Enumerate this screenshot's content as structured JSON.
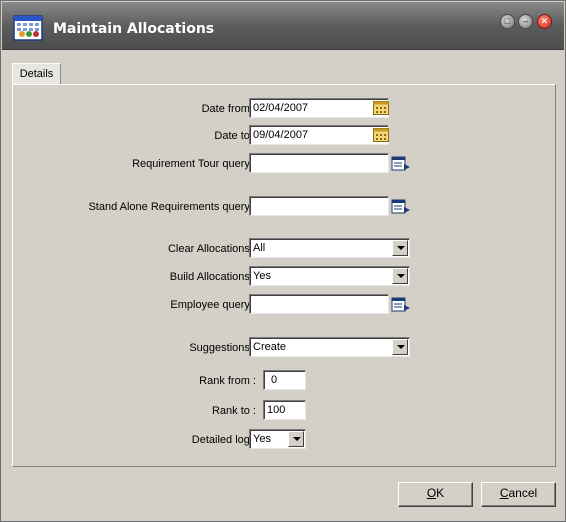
{
  "window": {
    "title": "Maintain Allocations",
    "controls": {
      "restore": "□",
      "minimize": "–",
      "close": "✕"
    }
  },
  "tabs": [
    {
      "label": "Details",
      "active": true
    }
  ],
  "form": {
    "date_from": {
      "label": "Date from :",
      "value": "02/04/2007"
    },
    "date_to": {
      "label": "Date to :",
      "value": "09/04/2007"
    },
    "req_tour": {
      "label": "Requirement Tour query :",
      "value": ""
    },
    "stand_alone": {
      "label": "Stand Alone Requirements query :",
      "value": ""
    },
    "clear_alloc": {
      "label": "Clear Allocations :",
      "value": "All"
    },
    "build_alloc": {
      "label": "Build Allocations :",
      "value": "Yes"
    },
    "employee": {
      "label": "Employee query :",
      "value": ""
    },
    "suggestions": {
      "label": "Suggestions :",
      "value": "Create"
    },
    "rank_from": {
      "label": "Rank from :",
      "value": "0"
    },
    "rank_to": {
      "label": "Rank to :",
      "value": "100"
    },
    "detailed_log": {
      "label": "Detailed log :",
      "value": "Yes"
    }
  },
  "buttons": {
    "ok": {
      "mnemonic": "O",
      "rest": "K"
    },
    "cancel": {
      "mnemonic": "C",
      "rest": "ancel"
    }
  },
  "colors": {
    "titlebar": "#5c5c5c",
    "dialog_bg": "#d4d0c8",
    "close_button": "#c8261a"
  }
}
